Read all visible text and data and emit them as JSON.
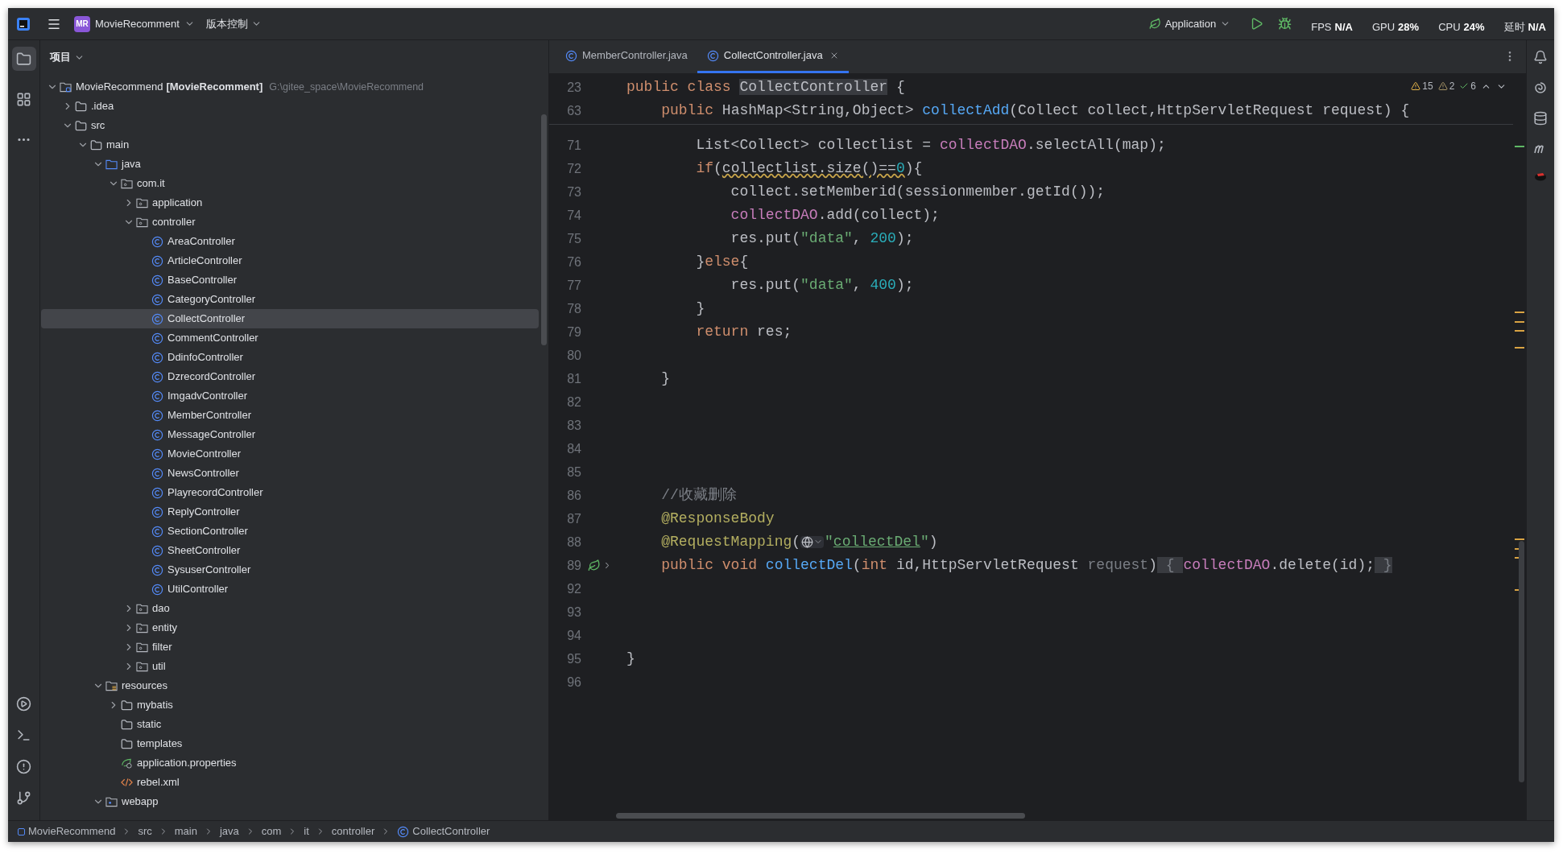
{
  "title_bar": {
    "project_badge": "MR",
    "project_name": "MovieRecomment",
    "vcs_menu": "版本控制",
    "run_config": "Application",
    "monitors": [
      {
        "label": "FPS",
        "value": "N/A"
      },
      {
        "label": "GPU",
        "value": "28%"
      },
      {
        "label": "CPU",
        "value": "24%"
      },
      {
        "label": "延时",
        "value": "N/A"
      }
    ]
  },
  "left_toolbar": {
    "top": [
      {
        "kind": "folder",
        "selected": true
      },
      {
        "kind": "structure",
        "selected": false
      },
      {
        "kind": "more",
        "selected": false
      }
    ],
    "bottom": [
      {
        "kind": "run"
      },
      {
        "kind": "terminal"
      },
      {
        "kind": "problems"
      },
      {
        "kind": "git"
      }
    ]
  },
  "project_panel": {
    "title": "项目",
    "tree": [
      {
        "kind": "module",
        "name": "MovieRecommend",
        "module": "[MovieRecomment]",
        "path": "G:\\gitee_space\\MovieRecommend",
        "expanded": true,
        "selected": false,
        "children": [
          {
            "kind": "folder",
            "name": ".idea",
            "expanded": false,
            "selected": false
          },
          {
            "kind": "folder",
            "name": "src",
            "expanded": true,
            "selected": false,
            "children": [
              {
                "kind": "folder",
                "name": "main",
                "expanded": true,
                "selected": false,
                "children": [
                  {
                    "kind": "source",
                    "name": "java",
                    "expanded": true,
                    "selected": false,
                    "children": [
                      {
                        "kind": "package",
                        "name": "com.it",
                        "expanded": true,
                        "selected": false,
                        "children": [
                          {
                            "kind": "package",
                            "name": "application",
                            "expanded": false,
                            "selected": false
                          },
                          {
                            "kind": "package",
                            "name": "controller",
                            "expanded": true,
                            "selected": false,
                            "children": [
                              {
                                "kind": "class",
                                "name": "AreaController",
                                "selected": false
                              },
                              {
                                "kind": "class",
                                "name": "ArticleController",
                                "selected": false
                              },
                              {
                                "kind": "class",
                                "name": "BaseController",
                                "selected": false
                              },
                              {
                                "kind": "class",
                                "name": "CategoryController",
                                "selected": false
                              },
                              {
                                "kind": "class",
                                "name": "CollectController",
                                "selected": true
                              },
                              {
                                "kind": "class",
                                "name": "CommentController",
                                "selected": false
                              },
                              {
                                "kind": "class",
                                "name": "DdinfoController",
                                "selected": false
                              },
                              {
                                "kind": "class",
                                "name": "DzrecordController",
                                "selected": false
                              },
                              {
                                "kind": "class",
                                "name": "ImgadvController",
                                "selected": false
                              },
                              {
                                "kind": "class",
                                "name": "MemberController",
                                "selected": false
                              },
                              {
                                "kind": "class",
                                "name": "MessageController",
                                "selected": false
                              },
                              {
                                "kind": "class",
                                "name": "MovieController",
                                "selected": false
                              },
                              {
                                "kind": "class",
                                "name": "NewsController",
                                "selected": false
                              },
                              {
                                "kind": "class",
                                "name": "PlayrecordController",
                                "selected": false
                              },
                              {
                                "kind": "class",
                                "name": "ReplyController",
                                "selected": false
                              },
                              {
                                "kind": "class",
                                "name": "SectionController",
                                "selected": false
                              },
                              {
                                "kind": "class",
                                "name": "SheetController",
                                "selected": false
                              },
                              {
                                "kind": "class",
                                "name": "SysuserController",
                                "selected": false
                              },
                              {
                                "kind": "class",
                                "name": "UtilController",
                                "selected": false
                              }
                            ]
                          },
                          {
                            "kind": "package",
                            "name": "dao",
                            "expanded": false,
                            "selected": false
                          },
                          {
                            "kind": "package",
                            "name": "entity",
                            "expanded": false,
                            "selected": false
                          },
                          {
                            "kind": "package",
                            "name": "filter",
                            "expanded": false,
                            "selected": false
                          },
                          {
                            "kind": "package",
                            "name": "util",
                            "expanded": false,
                            "selected": false
                          }
                        ]
                      }
                    ]
                  },
                  {
                    "kind": "resources",
                    "name": "resources",
                    "expanded": true,
                    "selected": false,
                    "children": [
                      {
                        "kind": "folder",
                        "name": "mybatis",
                        "expanded": false,
                        "selected": false
                      },
                      {
                        "kind": "folder",
                        "name": "static",
                        "selected": false
                      },
                      {
                        "kind": "folder",
                        "name": "templates",
                        "selected": false
                      },
                      {
                        "kind": "properties",
                        "name": "application.properties",
                        "selected": false
                      },
                      {
                        "kind": "xml",
                        "name": "rebel.xml",
                        "selected": false
                      }
                    ]
                  },
                  {
                    "kind": "webfolder",
                    "name": "webapp",
                    "expanded": true,
                    "selected": false
                  }
                ]
              }
            ]
          }
        ]
      }
    ]
  },
  "editor": {
    "tabs": [
      {
        "label": "MemberController.java",
        "selected": false
      },
      {
        "label": "CollectController.java",
        "selected": true
      }
    ],
    "inspections": {
      "warnings": "15",
      "weak_warnings": "2",
      "passed": "6"
    },
    "sticky_lines": [
      {
        "number": "23",
        "tokens": [
          {
            "kind": "keyword",
            "text": "public class "
          },
          {
            "kind": "class_highlight",
            "text": "CollectController"
          },
          {
            "kind": "plain",
            "text": " {"
          }
        ]
      },
      {
        "number": "63",
        "tokens": [
          {
            "kind": "keyword",
            "text": "    public "
          },
          {
            "kind": "plain",
            "text": "HashMap<String,Object> "
          },
          {
            "kind": "method",
            "text": "collectAdd"
          },
          {
            "kind": "plain",
            "text": "(Collect collect,HttpServletRequest request) {"
          }
        ]
      }
    ],
    "lines": [
      {
        "number": "71",
        "tokens": [
          {
            "kind": "plain",
            "text": "        List<Collect> collectlist = "
          },
          {
            "kind": "field",
            "text": "collectDAO"
          },
          {
            "kind": "plain",
            "text": ".selectAll(map);"
          }
        ]
      },
      {
        "number": "72",
        "tokens": [
          {
            "kind": "keyword",
            "text": "        if"
          },
          {
            "kind": "plain",
            "text": "("
          },
          {
            "kind": "warn",
            "text": "collectlist.size()=="
          },
          {
            "kind": "warn_number",
            "text": "0"
          },
          {
            "kind": "plain",
            "text": "){"
          }
        ]
      },
      {
        "number": "73",
        "tokens": [
          {
            "kind": "plain",
            "text": "            collect.setMemberid(sessionmember.getId());"
          }
        ]
      },
      {
        "number": "74",
        "tokens": [
          {
            "kind": "field",
            "text": "            collectDAO"
          },
          {
            "kind": "plain",
            "text": ".add(collect);"
          }
        ]
      },
      {
        "number": "75",
        "tokens": [
          {
            "kind": "plain",
            "text": "            res.put("
          },
          {
            "kind": "string",
            "text": "\"data\""
          },
          {
            "kind": "plain",
            "text": ", "
          },
          {
            "kind": "number",
            "text": "200"
          },
          {
            "kind": "plain",
            "text": ");"
          }
        ]
      },
      {
        "number": "76",
        "tokens": [
          {
            "kind": "plain",
            "text": "        }"
          },
          {
            "kind": "keyword",
            "text": "else"
          },
          {
            "kind": "plain",
            "text": "{"
          }
        ]
      },
      {
        "number": "77",
        "tokens": [
          {
            "kind": "plain",
            "text": "            res.put("
          },
          {
            "kind": "string",
            "text": "\"data\""
          },
          {
            "kind": "plain",
            "text": ", "
          },
          {
            "kind": "number",
            "text": "400"
          },
          {
            "kind": "plain",
            "text": ");"
          }
        ]
      },
      {
        "number": "78",
        "tokens": [
          {
            "kind": "plain",
            "text": "        }"
          }
        ]
      },
      {
        "number": "79",
        "tokens": [
          {
            "kind": "keyword",
            "text": "        return "
          },
          {
            "kind": "plain",
            "text": "res;"
          }
        ]
      },
      {
        "number": "80"
      },
      {
        "number": "81",
        "tokens": [
          {
            "kind": "plain",
            "text": "    }"
          }
        ]
      },
      {
        "number": "82"
      },
      {
        "number": "83"
      },
      {
        "number": "84"
      },
      {
        "number": "85"
      },
      {
        "number": "86",
        "tokens": [
          {
            "kind": "comment",
            "text": "    //收藏删除"
          }
        ]
      },
      {
        "number": "87",
        "tokens": [
          {
            "kind": "annotation",
            "text": "    @ResponseBody"
          }
        ]
      },
      {
        "number": "88",
        "tokens": [
          {
            "kind": "annotation",
            "text": "    @RequestMapping"
          },
          {
            "kind": "plain",
            "text": "("
          },
          {
            "kind": "url_inlay"
          },
          {
            "kind": "string",
            "text": "\""
          },
          {
            "kind": "link_string",
            "text": "collectDel"
          },
          {
            "kind": "string",
            "text": "\""
          },
          {
            "kind": "plain",
            "text": ")"
          }
        ]
      },
      {
        "number": "89",
        "endpoint_marker": true,
        "tokens": [
          {
            "kind": "keyword",
            "text": "    public void "
          },
          {
            "kind": "method",
            "text": "collectDel"
          },
          {
            "kind": "plain",
            "text": "("
          },
          {
            "kind": "keyword",
            "text": "int "
          },
          {
            "kind": "plain",
            "text": "id,HttpServletRequest "
          },
          {
            "kind": "unused",
            "text": "request"
          },
          {
            "kind": "plain",
            "text": ")"
          },
          {
            "kind": "fold",
            "text": " { "
          },
          {
            "kind": "field",
            "text": "collectDAO"
          },
          {
            "kind": "plain",
            "text": ".delete(id);"
          },
          {
            "kind": "fold",
            "text": " }"
          }
        ]
      },
      {
        "number": "92"
      },
      {
        "number": "93"
      },
      {
        "number": "94"
      },
      {
        "number": "95",
        "tokens": [
          {
            "kind": "plain",
            "text": "}"
          }
        ]
      },
      {
        "number": "96"
      }
    ]
  },
  "right_toolbar": [
    {
      "kind": "notifications"
    },
    {
      "kind": "ai"
    },
    {
      "kind": "database"
    },
    {
      "kind": "maven"
    },
    {
      "kind": "jrebel"
    }
  ],
  "breadcrumbs": [
    {
      "kind": "module",
      "label": "MovieRecommend"
    },
    {
      "kind": "folder",
      "label": "src"
    },
    {
      "kind": "folder",
      "label": "main"
    },
    {
      "kind": "folder",
      "label": "java"
    },
    {
      "kind": "folder",
      "label": "com"
    },
    {
      "kind": "folder",
      "label": "it"
    },
    {
      "kind": "folder",
      "label": "controller"
    },
    {
      "kind": "class",
      "label": "CollectController"
    }
  ]
}
